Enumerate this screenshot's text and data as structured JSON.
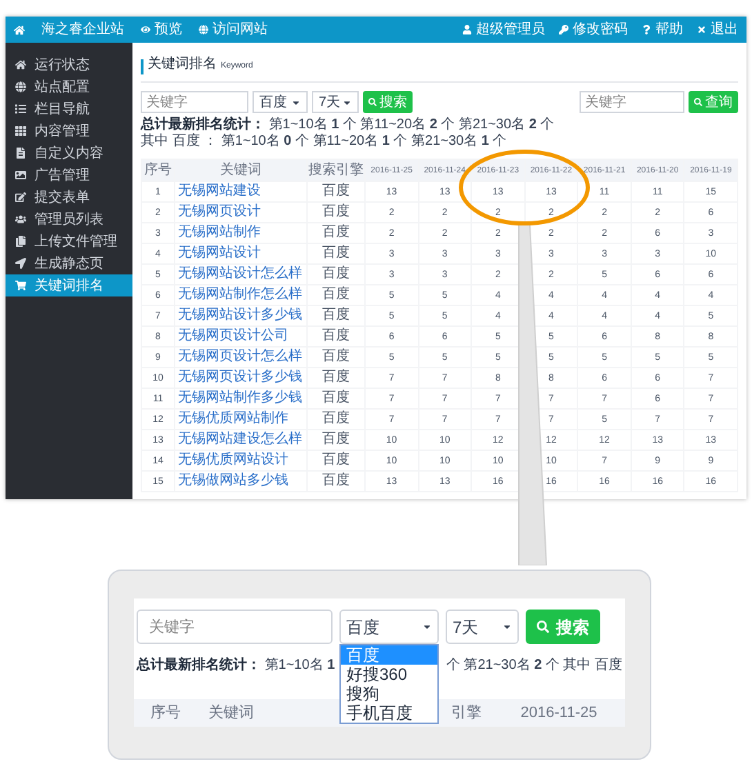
{
  "top_bar": {
    "site": "海之睿企业站",
    "links": [
      "预览",
      "访问网站"
    ],
    "user_links": [
      "超级管理员",
      "修改密码",
      "帮助",
      "退出"
    ]
  },
  "sidebar": {
    "items": [
      {
        "label": "运行状态",
        "selected": false
      },
      {
        "label": "站点配置",
        "selected": false
      },
      {
        "label": "栏目导航",
        "selected": false
      },
      {
        "label": "内容管理",
        "selected": false
      },
      {
        "label": "自定义内容",
        "selected": false
      },
      {
        "label": "广告管理",
        "selected": false
      },
      {
        "label": "提交表单",
        "selected": false
      },
      {
        "label": "管理员列表",
        "selected": false
      },
      {
        "label": "上传文件管理",
        "selected": false
      },
      {
        "label": "生成静态页",
        "selected": false
      },
      {
        "label": "关键词排名",
        "selected": true
      }
    ]
  },
  "page": {
    "title": "关键词排名",
    "subtitle": "Keyword"
  },
  "filters": {
    "keyword": {
      "placeholder": "关键字"
    },
    "engine": {
      "value": "百度"
    },
    "period": {
      "value": "7天"
    },
    "search_button": "搜索"
  },
  "query": {
    "keyword": {
      "placeholder": "关键字"
    },
    "button": "查询"
  },
  "stats": {
    "label": "总计最新排名统计：",
    "text": "第1~10名 **1** 个 第11~20名 **2** 个 第21~30名 **2** 个",
    "text_engine": "其中 百度 ： 第1~10名 **0** 个 第11~20名 **1** 个 第21~30名 **1** 个"
  },
  "table": {
    "columns": [
      "序号",
      "关键词",
      "搜索引擎",
      "2016-11-25",
      "2016-11-24",
      "2016-11-23",
      "2016-11-22",
      "2016-11-21",
      "2016-11-20",
      "2016-11-19"
    ],
    "rows": [
      [
        "1",
        "无锡网站建设",
        "百度",
        "13",
        "13",
        "13",
        "13",
        "11",
        "11",
        "15"
      ],
      [
        "2",
        "无锡网页设计",
        "百度",
        "2",
        "2",
        "2",
        "2",
        "2",
        "2",
        "6"
      ],
      [
        "3",
        "无锡网站制作",
        "百度",
        "2",
        "2",
        "2",
        "2",
        "2",
        "6",
        "3"
      ],
      [
        "4",
        "无锡网站设计",
        "百度",
        "3",
        "3",
        "3",
        "3",
        "3",
        "3",
        "10"
      ],
      [
        "5",
        "无锡网站设计怎么样",
        "百度",
        "3",
        "3",
        "2",
        "2",
        "5",
        "6",
        "6"
      ],
      [
        "6",
        "无锡网站制作怎么样",
        "百度",
        "5",
        "5",
        "4",
        "4",
        "4",
        "4",
        "4"
      ],
      [
        "7",
        "无锡网站设计多少钱",
        "百度",
        "5",
        "5",
        "4",
        "4",
        "4",
        "4",
        "5"
      ],
      [
        "8",
        "无锡网页设计公司",
        "百度",
        "6",
        "6",
        "5",
        "5",
        "6",
        "8",
        "8"
      ],
      [
        "9",
        "无锡网页设计怎么样",
        "百度",
        "5",
        "5",
        "5",
        "5",
        "5",
        "5",
        "5"
      ],
      [
        "10",
        "无锡网页设计多少钱",
        "百度",
        "7",
        "7",
        "8",
        "8",
        "6",
        "6",
        "7"
      ],
      [
        "11",
        "无锡网站制作多少钱",
        "百度",
        "7",
        "7",
        "7",
        "7",
        "7",
        "6",
        "7"
      ],
      [
        "12",
        "无锡优质网站制作",
        "百度",
        "7",
        "7",
        "7",
        "7",
        "5",
        "7",
        "7"
      ],
      [
        "13",
        "无锡网站建设怎么样",
        "百度",
        "10",
        "10",
        "12",
        "12",
        "12",
        "13",
        "13"
      ],
      [
        "14",
        "无锡优质网站设计",
        "百度",
        "10",
        "10",
        "10",
        "10",
        "7",
        "9",
        "9"
      ],
      [
        "15",
        "无锡做网站多少钱",
        "百度",
        "13",
        "13",
        "16",
        "16",
        "16",
        "16",
        "16"
      ]
    ]
  },
  "callout": {
    "keyword": {
      "placeholder": "关键字"
    },
    "engine": {
      "value": "百度",
      "expanded": true,
      "options": [
        {
          "label": "百度",
          "selected": true
        },
        {
          "label": "好搜360",
          "selected": false
        },
        {
          "label": "搜狗",
          "selected": false
        },
        {
          "label": "手机百度",
          "selected": false
        }
      ]
    },
    "period": {
      "value": "7天"
    },
    "search_button": "搜索",
    "stats_label": "总计最新排名统计：",
    "stats_left": "第1~10名 **1**",
    "stats_right": "个 第21~30名 **2** 个 其中 百度",
    "columns": [
      "序号",
      "关键词",
      "引擎",
      "2016-11-25"
    ]
  }
}
